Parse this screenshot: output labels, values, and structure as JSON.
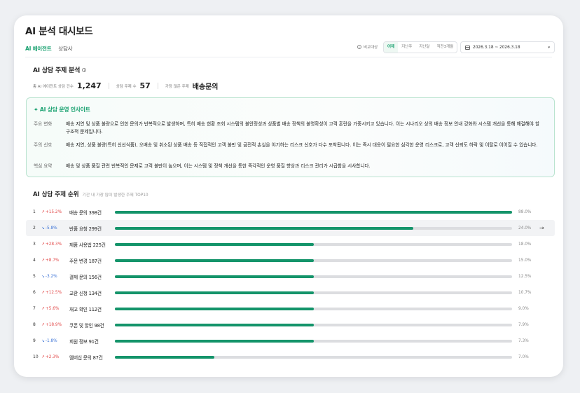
{
  "page_title": "AI 분석 대시보드",
  "tabs": [
    {
      "label": "AI 에이전트",
      "active": true
    },
    {
      "label": "상담사",
      "active": false
    }
  ],
  "filter": {
    "compare_label": "비교대상",
    "periods": [
      {
        "label": "어제",
        "active": true
      },
      {
        "label": "지난주",
        "active": false
      },
      {
        "label": "지난달",
        "active": false
      },
      {
        "label": "직전3개월",
        "active": false
      }
    ],
    "date_range": "2026.3.18 ~ 2026.3.18"
  },
  "topic_analysis": {
    "title": "AI 상담 주제 분석",
    "stats": {
      "total_label": "총 AI 에이전트 상담 건수",
      "total_value": "1,247",
      "topics_label": "상담 주제 수",
      "topics_value": "57",
      "top_label": "가장 많은 주제",
      "top_value": "배송문의"
    }
  },
  "insight": {
    "title": "✦ AI 상담 운영 인사이트",
    "rows": [
      {
        "label": "주요 변화",
        "text": "배송 지연 및 상품 불량으로 인한 문의가 반복적으로 발생하며, 특히 배송 현황 조회 시스템의 불안정성과 상품별 배송 정책의 불명확성이 고객 혼란을 가중시키고 있습니다. 이는 시나리오 상의 배송 정보 안내 강화와 시스템 개선을 통해 해결해야 할 구조적 문제입니다."
      },
      {
        "label": "주의 신호",
        "text": "배송 지연, 상품 불량(특히 신선식품), 오배송 및 취소된 상품 배송 등 직접적인 고객 불만 및 금전적 손실을 야기하는 리스크 신호가 다수 포착됩니다. 이는 즉시 대응이 필요한 심각한 운영 리스크로, 고객 신뢰도 하락 및 이탈로 이어질 수 있습니다."
      },
      {
        "label": "핵심 요약",
        "text": "배송 및 상품 품질 관련 반복적인 문제로 고객 불만이 높으며, 이는 시스템 및 정책 개선을 통한 즉각적인 운영 품질 향상과 리스크 관리가 시급함을 시사합니다."
      }
    ]
  },
  "ranking": {
    "title": "AI 상담 주제 순위",
    "subtitle": "기간 내 가장 많이 발생한 주제 TOP10",
    "items": [
      {
        "rank": "1",
        "change": "+15.2%",
        "dir": "up",
        "name": "배송 문의 398건",
        "pct": "88.0%",
        "fill": 1.0,
        "highlight": false
      },
      {
        "rank": "2",
        "change": "-5.8%",
        "dir": "down",
        "name": "반품 요청 299건",
        "pct": "24.0%",
        "fill": 0.752,
        "highlight": true
      },
      {
        "rank": "3",
        "change": "+28.3%",
        "dir": "up",
        "name": "제품 사용법 225건",
        "pct": "18.0%",
        "fill": 0.5,
        "highlight": false
      },
      {
        "rank": "4",
        "change": "+8.7%",
        "dir": "up",
        "name": "주문 변경 187건",
        "pct": "15.0%",
        "fill": 0.5,
        "highlight": false
      },
      {
        "rank": "5",
        "change": "-3.2%",
        "dir": "down",
        "name": "결제 문의 156건",
        "pct": "12.5%",
        "fill": 0.5,
        "highlight": false
      },
      {
        "rank": "6",
        "change": "+12.5%",
        "dir": "up",
        "name": "교환 신청 134건",
        "pct": "10.7%",
        "fill": 0.5,
        "highlight": false
      },
      {
        "rank": "7",
        "change": "+5.6%",
        "dir": "up",
        "name": "재고 확인 112건",
        "pct": "9.0%",
        "fill": 0.5,
        "highlight": false
      },
      {
        "rank": "8",
        "change": "+18.9%",
        "dir": "up",
        "name": "쿠폰 및 할인 98건",
        "pct": "7.9%",
        "fill": 0.5,
        "highlight": false
      },
      {
        "rank": "9",
        "change": "-1.8%",
        "dir": "down",
        "name": "회원 정보 91건",
        "pct": "7.3%",
        "fill": 0.5,
        "highlight": false
      },
      {
        "rank": "10",
        "change": "+2.3%",
        "dir": "up",
        "name": "멤버십 문의 87건",
        "pct": "7.0%",
        "fill": 0.25,
        "highlight": false
      }
    ]
  },
  "icons": {
    "up": "↗",
    "down": "↘",
    "row_arrow": "→",
    "caret": "▾",
    "info": "i"
  },
  "colors": {
    "accent": "#16a06e",
    "bar_fill": "#14946a",
    "bar_track": "#dcdde0",
    "up": "#e24a4a",
    "down": "#3c73d6"
  }
}
